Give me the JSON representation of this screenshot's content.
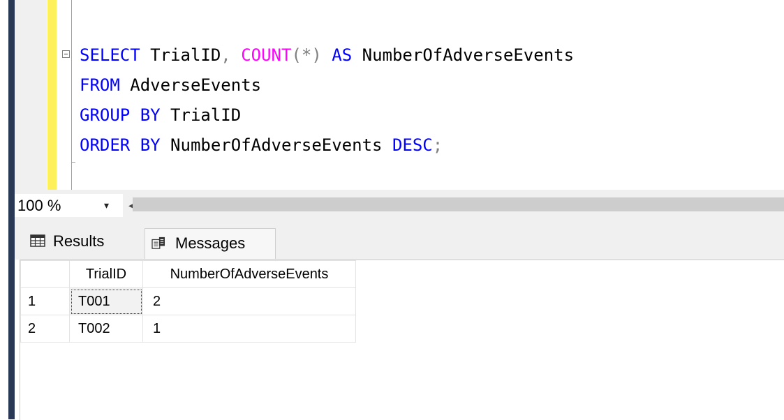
{
  "editor": {
    "lines": [
      {
        "segments": [
          {
            "t": "SELECT",
            "c": "kw"
          },
          {
            "t": " TrialID",
            "c": ""
          },
          {
            "t": ",",
            "c": "op"
          },
          {
            "t": " ",
            "c": ""
          },
          {
            "t": "COUNT",
            "c": "fn"
          },
          {
            "t": "(*)",
            "c": "op"
          },
          {
            "t": " ",
            "c": ""
          },
          {
            "t": "AS",
            "c": "kw"
          },
          {
            "t": " NumberOfAdverseEvents",
            "c": ""
          }
        ]
      },
      {
        "segments": [
          {
            "t": "FROM",
            "c": "kw"
          },
          {
            "t": " AdverseEvents",
            "c": ""
          }
        ]
      },
      {
        "segments": [
          {
            "t": "GROUP BY",
            "c": "kw"
          },
          {
            "t": " TrialID",
            "c": ""
          }
        ]
      },
      {
        "segments": [
          {
            "t": "ORDER BY",
            "c": "kw"
          },
          {
            "t": " NumberOfAdverseEvents ",
            "c": ""
          },
          {
            "t": "DESC",
            "c": "kw"
          },
          {
            "t": ";",
            "c": "op"
          }
        ]
      }
    ]
  },
  "statusbar": {
    "zoom": "100 %",
    "zoom_arrow": "▾",
    "scroll_left": "◀"
  },
  "tabs": {
    "results_label": "Results",
    "messages_label": "Messages"
  },
  "grid": {
    "columns": [
      "TrialID",
      "NumberOfAdverseEvents"
    ],
    "rows": [
      {
        "num": "1",
        "cells": [
          "T001",
          "2"
        ]
      },
      {
        "num": "2",
        "cells": [
          "T002",
          "1"
        ]
      }
    ]
  },
  "colors": {
    "keyword": "#0000ff",
    "function": "#ff00ff",
    "operator": "#808080",
    "change_bar": "#fef05a",
    "left_bar": "#293955"
  }
}
